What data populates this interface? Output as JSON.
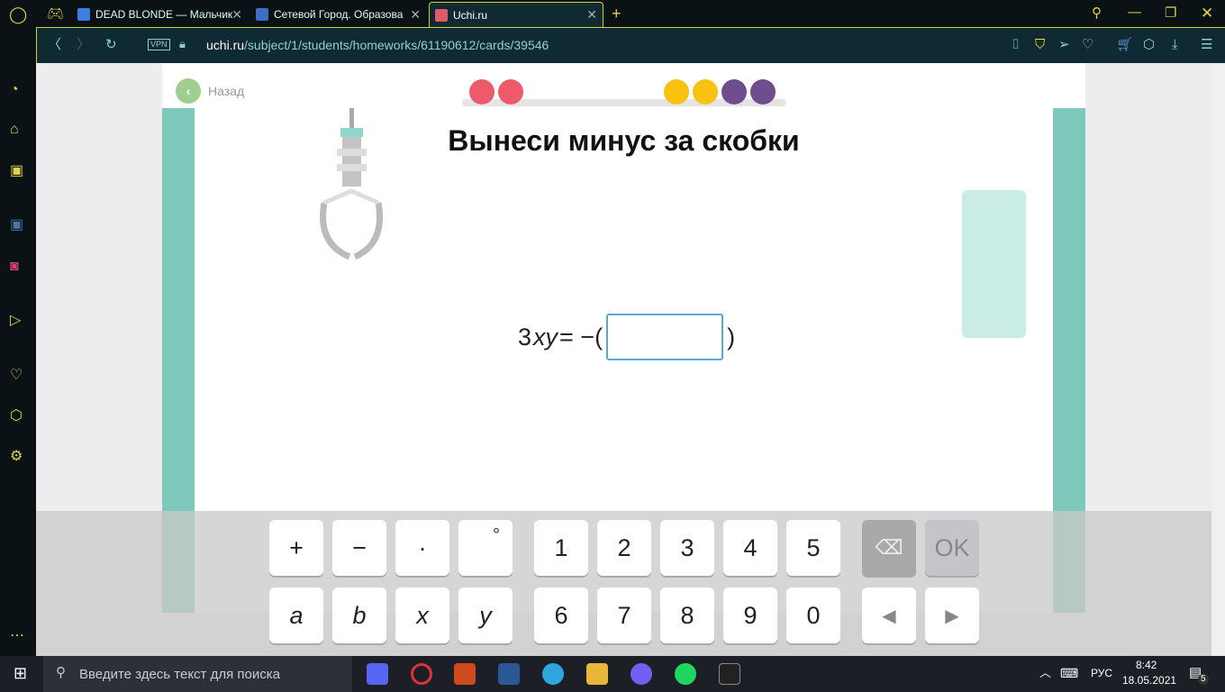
{
  "browser": {
    "tabs": [
      {
        "label": "DEAD BLONDE — Мальчик",
        "color": "#3b7de0"
      },
      {
        "label": "Сетевой Город. Образова",
        "color": "#3d6fc4"
      },
      {
        "label": "Uchi.ru",
        "color": "#e05a6a",
        "active": true
      }
    ],
    "new_tab": "+",
    "vpn": "VPN",
    "url_host": "uchi.ru",
    "url_path": "/subject/1/students/homeworks/61190612/cards/39546"
  },
  "page": {
    "back_label": "Назад",
    "progress_dots": [
      "#ef5a6a",
      "#ef5a6a",
      "#f8c20f",
      "#f8c20f",
      "#6f4e8f",
      "#6f4e8f"
    ],
    "title": "Вынеси минус за скобки",
    "equation": {
      "lhs_num": "3",
      "lhs_vars": "xy",
      "eq": "= −(",
      "close": ")"
    },
    "answer_value": ""
  },
  "keyboard": {
    "row1": [
      "+",
      "−",
      "·",
      "°",
      "1",
      "2",
      "3",
      "4",
      "5"
    ],
    "row2": [
      "a",
      "b",
      "x",
      "y",
      "6",
      "7",
      "8",
      "9",
      "0"
    ],
    "backspace": "⌫",
    "ok": "OK",
    "left": "◀",
    "right": "▶"
  },
  "taskbar": {
    "search_placeholder": "Введите здесь текст для поиска",
    "lang": "РУС",
    "time": "8:42",
    "date": "18.05.2021",
    "notifications": "5"
  }
}
